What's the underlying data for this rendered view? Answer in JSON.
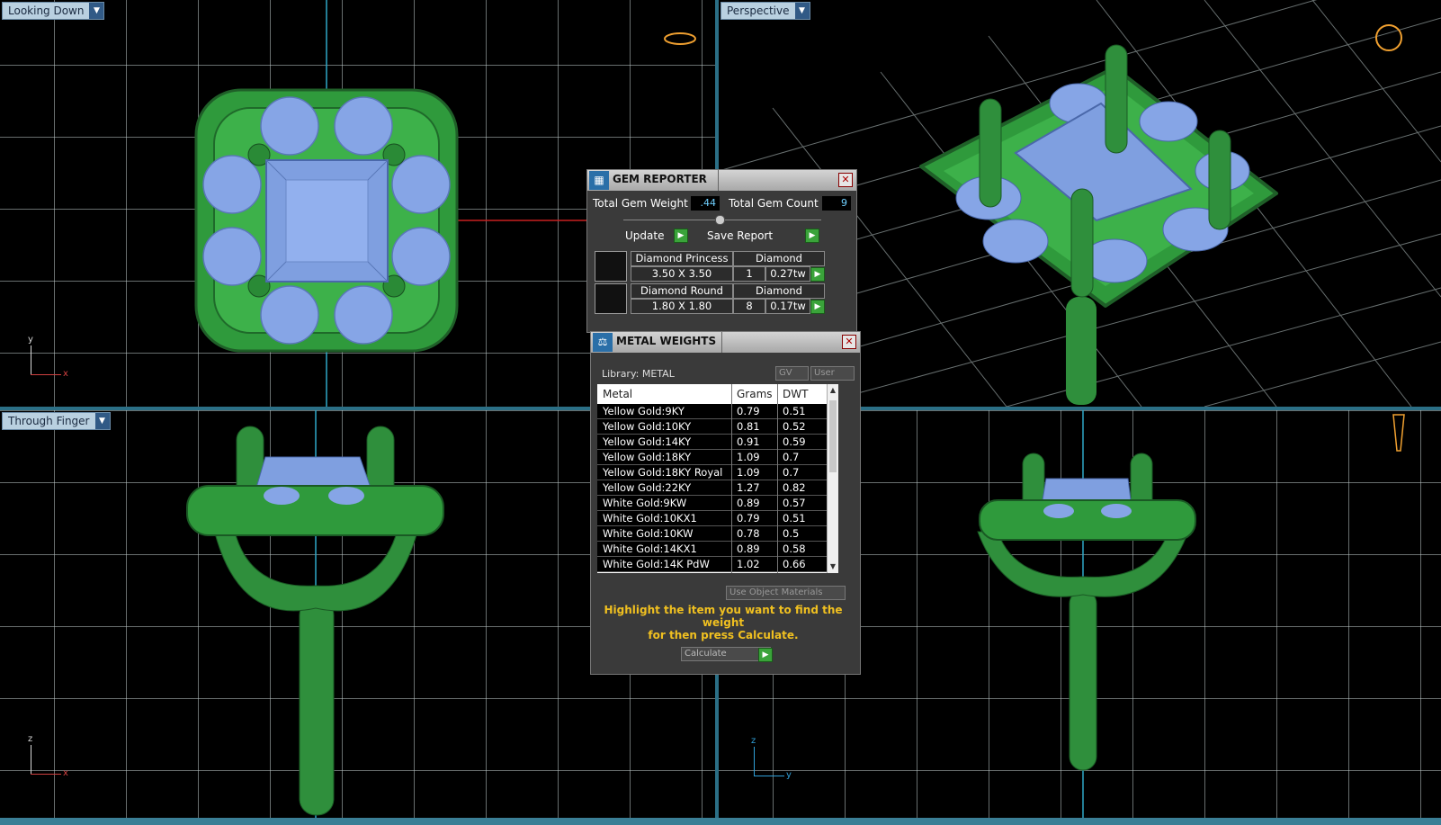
{
  "viewports": {
    "top_left": {
      "label": "Looking Down",
      "axis_v": "y",
      "axis_h": "x"
    },
    "top_right": {
      "label": "Perspective"
    },
    "bottom_left": {
      "label": "Through Finger",
      "axis_v": "z",
      "axis_h": "x"
    },
    "bottom_right": {
      "axis_v": "z",
      "axis_h": "y"
    }
  },
  "gem_reporter": {
    "title": "GEM REPORTER",
    "total_weight_label": "Total Gem Weight",
    "total_weight_value": ".44",
    "total_count_label": "Total Gem Count",
    "total_count_value": "9",
    "update_label": "Update",
    "save_label": "Save Report",
    "gems": [
      {
        "name": "Diamond Princess",
        "material": "Diamond",
        "size": "3.50 X 3.50",
        "count": "1",
        "weight": "0.27tw"
      },
      {
        "name": "Diamond Round",
        "material": "Diamond",
        "size": "1.80 X 1.80",
        "count": "8",
        "weight": "0.17tw"
      }
    ]
  },
  "metal_weights": {
    "title": "METAL WEIGHTS",
    "library": "Library: METAL",
    "gv_label": "GV",
    "user_label": "User",
    "columns": [
      "Metal",
      "Grams",
      "DWT"
    ],
    "rows": [
      [
        "Yellow Gold:9KY",
        "0.79",
        "0.51"
      ],
      [
        "Yellow Gold:10KY",
        "0.81",
        "0.52"
      ],
      [
        "Yellow Gold:14KY",
        "0.91",
        "0.59"
      ],
      [
        "Yellow Gold:18KY",
        "1.09",
        "0.7"
      ],
      [
        "Yellow Gold:18KY Royal",
        "1.09",
        "0.7"
      ],
      [
        "Yellow Gold:22KY",
        "1.27",
        "0.82"
      ],
      [
        "White Gold:9KW",
        "0.89",
        "0.57"
      ],
      [
        "White Gold:10KX1",
        "0.79",
        "0.51"
      ],
      [
        "White Gold:10KW",
        "0.78",
        "0.5"
      ],
      [
        "White Gold:14KX1",
        "0.89",
        "0.58"
      ],
      [
        "White Gold:14K PdW",
        "1.02",
        "0.66"
      ]
    ],
    "use_object_materials": "Use Object Materials",
    "hint_line1": "Highlight the item you want to find the weight",
    "hint_line2": "for then press Calculate.",
    "calculate_label": "Calculate"
  },
  "colors": {
    "metal": "#2f8f3c",
    "gem": "#7f9fe0",
    "grid": "#bcc6c6",
    "splitter": "#2b6f86"
  }
}
